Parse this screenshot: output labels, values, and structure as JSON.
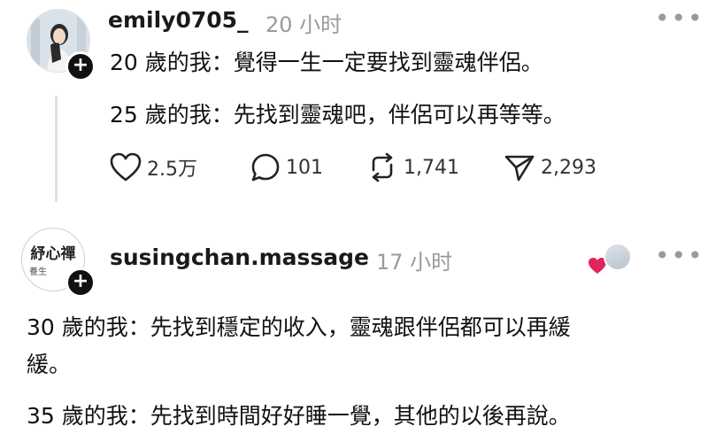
{
  "post": {
    "username": "emily0705_",
    "time": "20 小时",
    "line1": "20 歲的我：覺得一生一定要找到靈魂伴侶。",
    "line2": "25 歲的我：先找到靈魂吧，伴侶可以再等等。",
    "likes": "2.5万",
    "comments": "101",
    "reposts": "1,741",
    "shares": "2,293"
  },
  "reply": {
    "username": "susingchan.massage",
    "time": "17 小时",
    "avatar_text_top": "紓心禪",
    "avatar_text_bottom": "養生",
    "line1": "30 歲的我：先找到穩定的收入，靈魂跟伴侶都可以再緩",
    "line1b": "緩。",
    "line2": "35 歲的我：先找到時間好好睡一覺，其他的以後再說。"
  },
  "icons": {
    "more": "more-icon",
    "like": "heart-icon",
    "comment": "comment-icon",
    "repost": "repost-icon",
    "share": "send-icon",
    "follow": "plus-icon"
  },
  "colors": {
    "accent_heart": "#e0245e",
    "muted": "#9a9a9a"
  }
}
